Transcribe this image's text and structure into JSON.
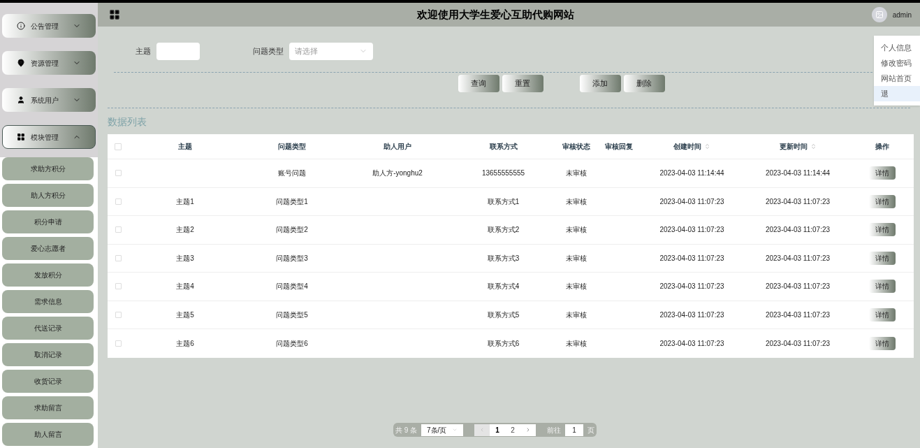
{
  "header": {
    "title": "欢迎使用大学生爱心互助代购网站",
    "user": "admin"
  },
  "user_menu": [
    {
      "label": "个人信息",
      "hovered": false
    },
    {
      "label": "修改密码",
      "hovered": false
    },
    {
      "label": "网站首页",
      "hovered": false
    },
    {
      "label": "退",
      "hovered": true
    }
  ],
  "sidebar": {
    "menus": [
      {
        "label": "公告管理",
        "expanded": false
      },
      {
        "label": "资源管理",
        "expanded": false
      },
      {
        "label": "系统用户",
        "expanded": false
      },
      {
        "label": "模块管理",
        "expanded": true,
        "children": [
          "求助方积分",
          "助人方积分",
          "积分申请",
          "爱心志愿者",
          "发放积分",
          "需求信息",
          "代送记录",
          "取消记录",
          "收货记录",
          "求助留言",
          "助人留言"
        ]
      }
    ]
  },
  "filters": [
    {
      "label": "主题",
      "kind": "text"
    },
    {
      "label": "问题类型",
      "kind": "select",
      "placeholder": "请选择"
    }
  ],
  "actions": [
    "查询",
    "重置",
    "添加",
    "删除"
  ],
  "list_title": "数据列表",
  "table": {
    "select_all_checked": false,
    "columns": [
      {
        "label": "主题",
        "sortable": false
      },
      {
        "label": "问题类型",
        "sortable": false
      },
      {
        "label": "助人用户",
        "sortable": false
      },
      {
        "label": "联系方式",
        "sortable": false
      },
      {
        "label": "审核状态",
        "sortable": false
      },
      {
        "label": "审核回复",
        "sortable": false
      },
      {
        "label": "创建时间",
        "sortable": true
      },
      {
        "label": "更新时间",
        "sortable": true
      },
      {
        "label": "操作",
        "sortable": false
      }
    ],
    "rows": [
      {
        "checked": false,
        "cells": [
          "",
          "账号问题",
          "助人方-yonghu2",
          "13655555555",
          "未审核",
          "",
          "2023-04-03 11:14:44",
          "2023-04-03 11:14:44"
        ],
        "action": "详情"
      },
      {
        "checked": false,
        "cells": [
          "主题1",
          "问题类型1",
          "",
          "联系方式1",
          "未审核",
          "",
          "2023-04-03 11:07:23",
          "2023-04-03 11:07:23"
        ],
        "action": "详情"
      },
      {
        "checked": false,
        "cells": [
          "主题2",
          "问题类型2",
          "",
          "联系方式2",
          "未审核",
          "",
          "2023-04-03 11:07:23",
          "2023-04-03 11:07:23"
        ],
        "action": "详情"
      },
      {
        "checked": false,
        "cells": [
          "主题3",
          "问题类型3",
          "",
          "联系方式3",
          "未审核",
          "",
          "2023-04-03 11:07:23",
          "2023-04-03 11:07:23"
        ],
        "action": "详情"
      },
      {
        "checked": false,
        "cells": [
          "主题4",
          "问题类型4",
          "",
          "联系方式4",
          "未审核",
          "",
          "2023-04-03 11:07:23",
          "2023-04-03 11:07:23"
        ],
        "action": "详情"
      },
      {
        "checked": false,
        "cells": [
          "主题5",
          "问题类型5",
          "",
          "联系方式5",
          "未审核",
          "",
          "2023-04-03 11:07:23",
          "2023-04-03 11:07:23"
        ],
        "action": "详情"
      },
      {
        "checked": false,
        "cells": [
          "主题6",
          "问题类型6",
          "",
          "联系方式6",
          "未审核",
          "",
          "2023-04-03 11:07:23",
          "2023-04-03 11:07:23"
        ],
        "action": "详情"
      }
    ]
  },
  "pagination": {
    "total": "共 9 条",
    "page_size": "7条/页",
    "pages": [
      {
        "label": "1",
        "selected": true
      },
      {
        "label": "2",
        "selected": false
      }
    ],
    "goto_label": "前往",
    "goto_value": "1",
    "goto_suffix": "页"
  }
}
